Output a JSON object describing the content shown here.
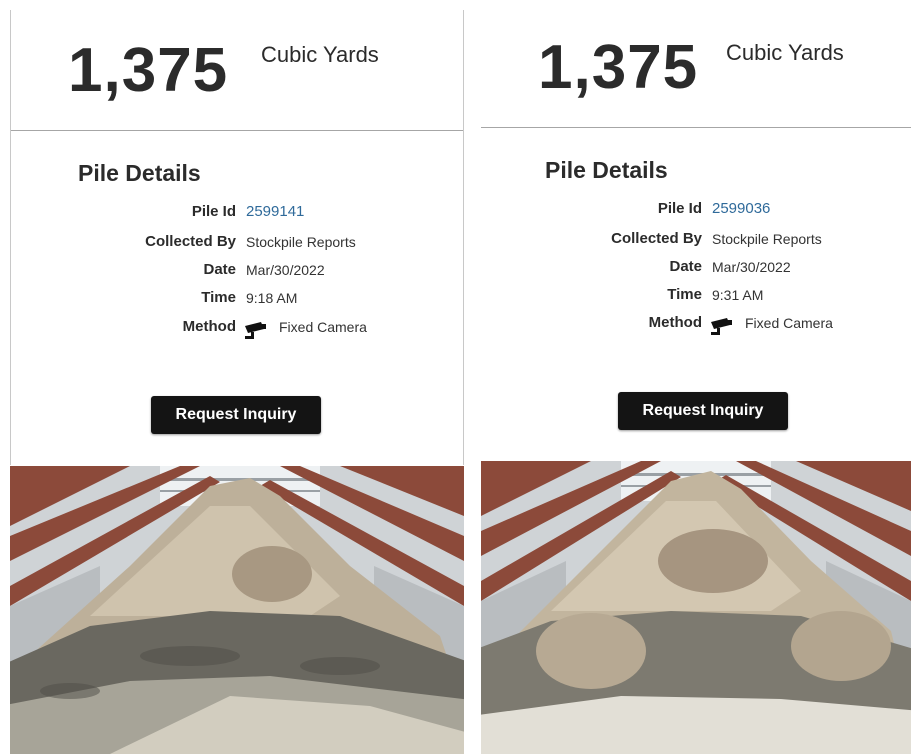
{
  "panels": [
    {
      "volume_value": "1,375",
      "volume_unit": "Cubic Yards",
      "details_title": "Pile Details",
      "rows": [
        {
          "label": "Pile Id",
          "value": "2599141"
        },
        {
          "label": "Collected By",
          "value": "Stockpile Reports"
        },
        {
          "label": "Date",
          "value": "Mar/30/2022"
        },
        {
          "label": "Time",
          "value": "9:18 AM"
        },
        {
          "label": "Method",
          "value": "Fixed Camera",
          "icon": "security-camera-icon"
        }
      ],
      "button_label": "Request Inquiry"
    },
    {
      "volume_value": "1,375",
      "volume_unit": "Cubic Yards",
      "details_title": "Pile Details",
      "rows": [
        {
          "label": "Pile Id",
          "value": "2599036"
        },
        {
          "label": "Collected By",
          "value": "Stockpile Reports"
        },
        {
          "label": "Date",
          "value": "Mar/30/2022"
        },
        {
          "label": "Time",
          "value": "9:31 AM"
        },
        {
          "label": "Method",
          "value": "Fixed Camera",
          "icon": "security-camera-icon"
        }
      ],
      "button_label": "Request Inquiry"
    }
  ],
  "colors": {
    "link": "#2f6a9a",
    "button_bg": "#141414",
    "divider": "#a6a6a6",
    "rafter": "#8c4a3a"
  }
}
